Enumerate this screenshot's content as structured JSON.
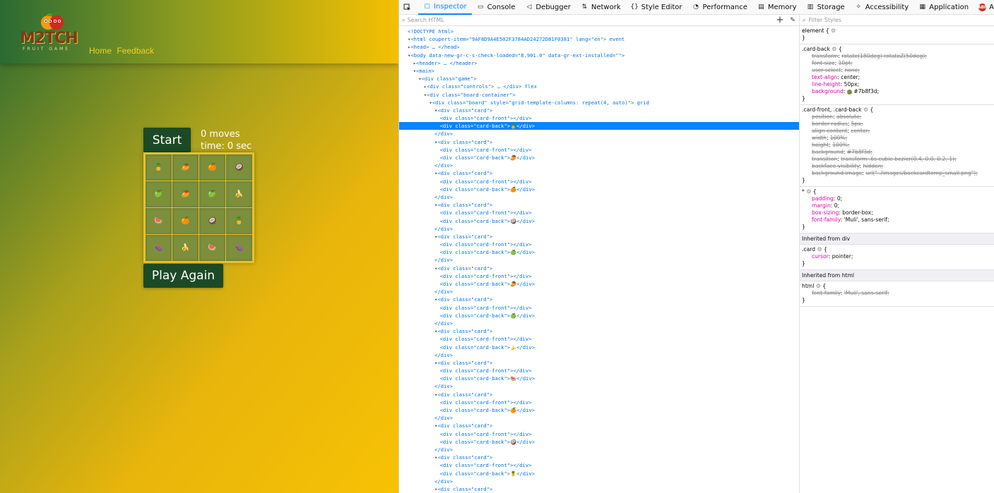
{
  "page": {
    "logo_text": "M2TCH",
    "logo_subtitle": "FRUIT GAME",
    "nav": [
      "Home",
      "Feedback"
    ],
    "start_label": "Start",
    "moves": "0 moves",
    "time": "time: 0 sec",
    "play_again_label": "Play Again",
    "cards": [
      "🍍",
      "🥭",
      "🍊",
      "🥥",
      "🍏",
      "🥭",
      "🍏",
      "🍌",
      "🍉",
      "🍊",
      "🥥",
      "🍍",
      "🍆",
      "🍌",
      "🍉",
      "🍆"
    ]
  },
  "devtools": {
    "tabs": [
      {
        "label": "Inspector",
        "icon": "inspector-icon",
        "active": true
      },
      {
        "label": "Console",
        "icon": "console-icon"
      },
      {
        "label": "Debugger",
        "icon": "debugger-icon"
      },
      {
        "label": "Network",
        "icon": "network-icon"
      },
      {
        "label": "Style Editor",
        "icon": "style-editor-icon"
      },
      {
        "label": "Performance",
        "icon": "performance-icon"
      },
      {
        "label": "Memory",
        "icon": "memory-icon"
      },
      {
        "label": "Storage",
        "icon": "storage-icon"
      },
      {
        "label": "Accessibility",
        "icon": "accessibility-icon"
      },
      {
        "label": "Application",
        "icon": "application-icon"
      },
      {
        "label": "Adblock Plus",
        "icon": "adblock-plus-icon"
      }
    ],
    "search_placeholder": "Search HTML",
    "filter_placeholder": "Filter Styles",
    "markup_lines": [
      "<!DOCTYPE html>",
      "<html coupert-item=\"9AF8D9A4E502F3784AD24272D81F0381\" lang=\"en\"> event",
      "<head> … </head>",
      "<body data-new-gr-c-s-check-loaded=\"8.901.0\" data-gr-ext-installed=\"\">",
      "<header> … </header>",
      "<main>",
      "<div class=\"game\">",
      "<div class=\"controls\"> … </div> flex",
      "<div class=\"board-container\">",
      "<div class=\"board\" style=\"grid-template-columns: repeat(4, auto)\"> grid",
      "<div class=\"card\">",
      "<div class=\"card-front\"></div>",
      "<div class=\"card-back\">🍍</div>",
      "</div>"
    ],
    "card_back_emojis": [
      "🍍",
      "🥭",
      "🍊",
      "🥥",
      "🍏",
      "🥭",
      "🍏",
      "🍌",
      "🍉",
      "🍊",
      "🥥",
      "🍍",
      "🍆"
    ],
    "styles": {
      "element_selector": "element {",
      "card_back_selector": ".card-back",
      "card_back_props": [
        {
          "name": "transform",
          "value": "rotate(180deg) rotateZ(50deg);",
          "struck": true
        },
        {
          "name": "font-size",
          "value": "10pt;",
          "struck": true
        },
        {
          "name": "user-select",
          "value": "none;",
          "struck": true
        },
        {
          "name": "text-align",
          "value": "center;",
          "struck": false
        },
        {
          "name": "line-height",
          "value": "50px;",
          "struck": false
        },
        {
          "name": "background",
          "value": "#7b8f3d;",
          "struck": false
        }
      ],
      "front_back_selector": ".card-front, .card-back",
      "front_back_props": [
        {
          "name": "position",
          "value": "absolute;",
          "struck": true
        },
        {
          "name": "border-radius",
          "value": "5px;",
          "struck": true
        },
        {
          "name": "align-content",
          "value": "center;",
          "struck": true
        },
        {
          "name": "width",
          "value": "100%;",
          "struck": true
        },
        {
          "name": "height",
          "value": "100%;",
          "struck": true
        },
        {
          "name": "background",
          "value": "#7b8f3d;",
          "struck": true
        },
        {
          "name": "transition",
          "value": "transform .6s cubic-bezier(0.4, 0.0, 0.2, 1);",
          "struck": true
        },
        {
          "name": "backface-visibility",
          "value": "hidden;",
          "struck": true
        },
        {
          "name": "background-image",
          "value": "url(\"../images/backcardtemp_small.png\");",
          "struck": true
        }
      ],
      "universal_selector": "*",
      "universal_props": [
        {
          "name": "padding",
          "value": "0;",
          "struck": false
        },
        {
          "name": "margin",
          "value": "0;",
          "struck": false
        },
        {
          "name": "box-sizing",
          "value": "border-box;",
          "struck": false
        },
        {
          "name": "font-family",
          "value": "'Muli', sans-serif;",
          "struck": false
        }
      ],
      "inherited_div": "Inherited from div",
      "card_selector": ".card",
      "card_props": [
        {
          "name": "cursor",
          "value": "pointer;",
          "struck": false
        }
      ],
      "inherited_html": "Inherited from html",
      "html_selector": "html",
      "html_props": [
        {
          "name": "font-family",
          "value": "'Muli', sans-serif;",
          "struck": true
        }
      ]
    },
    "colors": {
      "accent": "#0a84ff",
      "swatch": "#7b8f3d"
    }
  }
}
